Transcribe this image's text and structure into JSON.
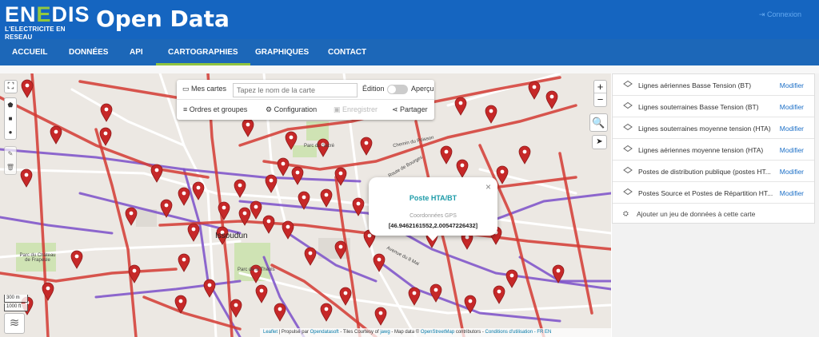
{
  "header": {
    "logo_text_1": "EN",
    "logo_text_2": "E",
    "logo_text_3": "DIS",
    "logo_tagline": "L'ELECTRICITE EN RESEAU",
    "title": "Open Data",
    "login_label": "Connexion"
  },
  "nav": {
    "items": [
      {
        "label": "ACCUEIL"
      },
      {
        "label": "DONNÉES"
      },
      {
        "label": "API"
      },
      {
        "label": "CARTOGRAPHIES"
      },
      {
        "label": "GRAPHIQUES"
      },
      {
        "label": "CONTACT"
      }
    ],
    "active_index": 3
  },
  "toolbar": {
    "maps_label": "Mes cartes",
    "search_placeholder": "Tapez le nom de la carte",
    "edition_label": "Édition",
    "preview_label": "Aperçu",
    "groups_label": "Ordres et groupes",
    "config_label": "Configuration",
    "save_label": "Enregistrer",
    "share_label": "Partager"
  },
  "map_controls": {
    "fullscreen": "fullscreen-icon",
    "zoom_in": "+",
    "zoom_out": "−",
    "search": "search-icon",
    "locate": "locate-icon"
  },
  "map_labels": {
    "parc_sacre": "Parc du Sacré",
    "town": "Issoudun",
    "parc_chateau": "Parc du Château de Frapesle",
    "parc_theols": "Parc de la Théols",
    "route_bourges": "Route de Bourges",
    "avenue_8mai": "Avenue du 8 Mai",
    "chemin_poisson": "Chemin du Poisson"
  },
  "popup": {
    "title": "Poste HTA/BT",
    "gps_label": "Coordonnées GPS",
    "gps_value": "[46.9462161552,2.00547226432]",
    "close": "×"
  },
  "scale": {
    "metric": "300 m",
    "imperial": "1000 ft"
  },
  "attribution": {
    "leaflet": "Leaflet",
    "powered": "| Propulsé par",
    "ods": "Opendatasoft",
    "tiles": "- Tiles Courtesy of",
    "jawg": "jawg",
    "mapdata": "- Map data ©",
    "osm": "OpenStreetMap",
    "contributors": "contributors -",
    "conditions": "Conditions d'utilisation",
    "lang": "- FR EN"
  },
  "panel": {
    "edit_label": "Modifier",
    "layers": [
      {
        "name": "Lignes aériennes Basse Tension (BT)"
      },
      {
        "name": "Lignes souterraines Basse Tension (BT)"
      },
      {
        "name": "Lignes souterraines moyenne tension (HTA)"
      },
      {
        "name": "Lignes aériennes moyenne tension (HTA)"
      },
      {
        "name": "Postes de distribution publique (postes HT..."
      },
      {
        "name": "Postes Source et Postes de Répartition HT..."
      }
    ],
    "add_dataset": "Ajouter un jeu de données à cette carte"
  },
  "colors": {
    "header_bg": "#1565c0",
    "nav_active": "#8fc43f",
    "line_red": "#d33a32",
    "line_purple": "#7b4fc9",
    "marker": "#c62828",
    "popup_title": "#1c9ba8"
  }
}
